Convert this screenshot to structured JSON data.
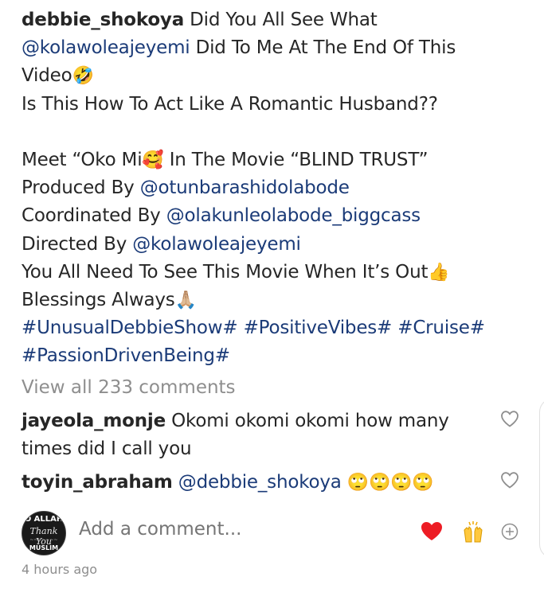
{
  "caption": {
    "username": "debbie_shokoya",
    "l1": "Did You All See What",
    "l2_mention": "@kolawoleajeyemi",
    "l2_rest": "Did To Me At The End Of This",
    "l3_text": "Video",
    "l3_emoji": "🤣",
    "l4": "Is This How To Act Like A Romantic Husband??",
    "l5_a": "Meet “Oko Mi",
    "l5_emoji": "🥰",
    "l5_b": "In The Movie “BLIND TRUST”",
    "l6_label": "Produced By",
    "l6_mention": "@otunbarashidolabode",
    "l7_label": "Coordinated By",
    "l7_mention": "@olakunleolabode_biggcass",
    "l8_label": "Directed By",
    "l8_mention": "@kolawoleajeyemi",
    "l9_text": "You All Need To See This Movie When It’s Out",
    "l9_emoji": "👍",
    "l10_text": "Blessings Always",
    "l10_emoji": "🙏🏼",
    "tag1": "#UnusualDebbieShow#",
    "tag2": "#PositiveVibes#",
    "tag3": "#Cruise#",
    "tag4": "#PassionDrivenBeing#"
  },
  "view_all": "View all 233 comments",
  "comments": [
    {
      "user": "jayeola_monje",
      "text": "Okomi okomi okomi how many times did I call you"
    },
    {
      "user": "toyin_abraham",
      "mention": "@debbie_shokoya",
      "emoji": "🙄🙄🙄🙄"
    }
  ],
  "add_comment": {
    "placeholder": "Add a comment...",
    "avatar_line1": "O ALLAH",
    "avatar_line2": "Thank You",
    "avatar_line4": "MUSLIM"
  },
  "timestamp": "4 hours ago",
  "colors": {
    "text": "#262626",
    "link": "#1b3b78",
    "muted": "#8e8e8e",
    "heart": "#ed1c24"
  }
}
